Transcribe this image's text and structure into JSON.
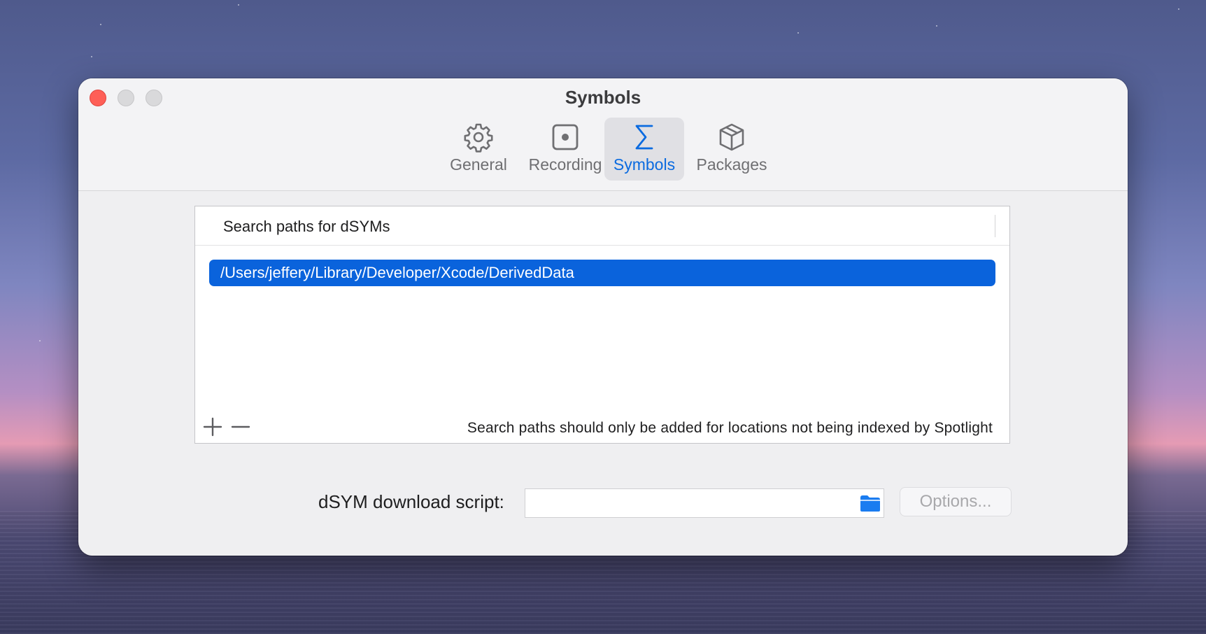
{
  "window": {
    "title": "Symbols"
  },
  "tabs": [
    {
      "label": "General",
      "icon": "gear-icon"
    },
    {
      "label": "Recording",
      "icon": "record-icon"
    },
    {
      "label": "Symbols",
      "icon": "sigma-icon",
      "active": true
    },
    {
      "label": "Packages",
      "icon": "package-icon"
    }
  ],
  "search_paths": {
    "header": "Search paths for dSYMs",
    "items": [
      "/Users/jeffery/Library/Developer/Xcode/DerivedData"
    ],
    "hint": "Search paths should only be added for locations not being indexed by Spotlight"
  },
  "download_script": {
    "label": "dSYM download script:",
    "value": "",
    "options_label": "Options..."
  },
  "colors": {
    "accent": "#0a63dc",
    "close": "#fe5f57"
  }
}
